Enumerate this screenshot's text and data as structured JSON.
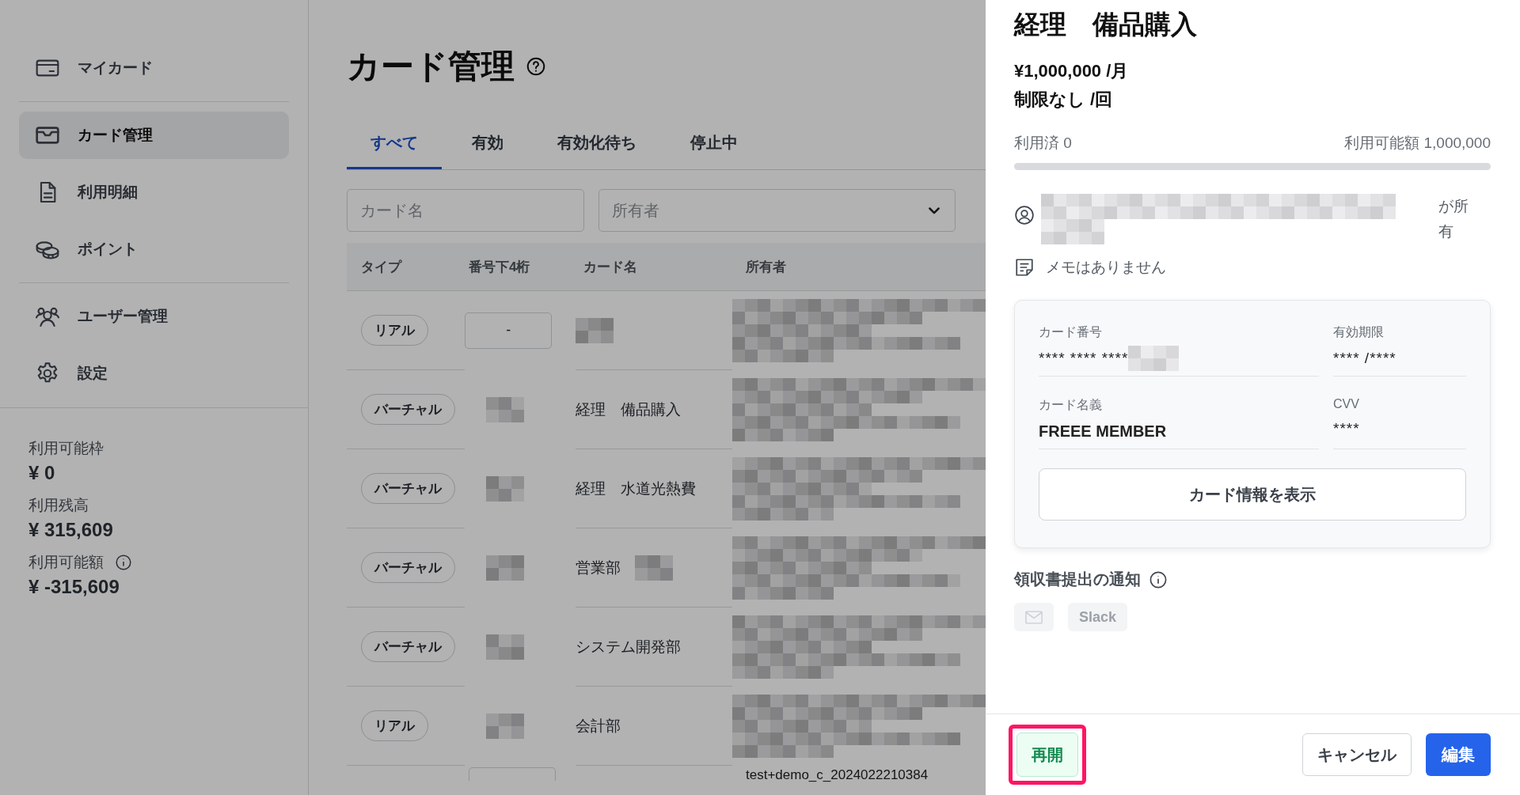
{
  "sidebar": {
    "nav_groups": [
      [
        {
          "label": "マイカード",
          "kind": "card",
          "selected": false
        }
      ],
      [
        {
          "label": "カード管理",
          "kind": "tray",
          "selected": true
        },
        {
          "label": "利用明細",
          "kind": "document",
          "selected": false
        },
        {
          "label": "ポイント",
          "kind": "coins",
          "selected": false
        }
      ],
      [
        {
          "label": "ユーザー管理",
          "kind": "users",
          "selected": false
        },
        {
          "label": "設定",
          "kind": "settings",
          "selected": false
        }
      ]
    ],
    "balances": [
      {
        "label": "利用可能枠",
        "value": "¥ 0",
        "info": false
      },
      {
        "label": "利用残高",
        "value": "¥ 315,609",
        "info": false
      },
      {
        "label": "利用可能額",
        "value": "¥ -315,609",
        "info": true
      }
    ]
  },
  "main": {
    "title": "カード管理",
    "tabs": [
      {
        "label": "すべて",
        "selected": true
      },
      {
        "label": "有効",
        "selected": false
      },
      {
        "label": "有効化待ち",
        "selected": false
      },
      {
        "label": "停止中",
        "selected": false
      }
    ],
    "filters": {
      "card_name_placeholder": "カード名",
      "owner_placeholder": "所有者"
    },
    "table": {
      "columns": [
        "タイプ",
        "番号下4桁",
        "カード名",
        "所有者"
      ],
      "rows": [
        {
          "type": "リアル",
          "last4": {
            "kind": "text",
            "text": "-"
          },
          "name": {
            "kind": "redacted"
          },
          "owner": {
            "kind": "redacted"
          }
        },
        {
          "type": "バーチャル",
          "last4": {
            "kind": "redacted"
          },
          "name": {
            "kind": "text",
            "text": "経理　備品購入"
          },
          "owner": {
            "kind": "redacted"
          }
        },
        {
          "type": "バーチャル",
          "last4": {
            "kind": "redacted"
          },
          "name": {
            "kind": "text",
            "text": "経理　水道光熱費"
          },
          "owner": {
            "kind": "redacted"
          }
        },
        {
          "type": "バーチャル",
          "last4": {
            "kind": "redacted"
          },
          "name": {
            "kind": "text_redacted",
            "text": "営業部"
          },
          "owner": {
            "kind": "redacted"
          }
        },
        {
          "type": "バーチャル",
          "last4": {
            "kind": "redacted"
          },
          "name": {
            "kind": "text",
            "text": "システム開発部"
          },
          "owner": {
            "kind": "redacted"
          }
        },
        {
          "type": "リアル",
          "last4": {
            "kind": "redacted"
          },
          "name": {
            "kind": "text",
            "text": "会計部"
          },
          "owner": {
            "kind": "redacted"
          }
        },
        {
          "last4": {
            "kind": "box"
          },
          "owner": {
            "kind": "text",
            "text": "test+demo_c_2024022210384"
          }
        }
      ]
    }
  },
  "drawer": {
    "title": "経理　備品購入",
    "monthly_limit": "¥1,000,000 /月",
    "per_use_limit": "制限なし /回",
    "usage": {
      "used": "利用済 0",
      "available": "利用可能額 1,000,000",
      "level": 0
    },
    "owner": {
      "redacted": true,
      "suffix": "が所有"
    },
    "memo": "メモはありません",
    "card": {
      "fields": [
        {
          "label": "カード番号",
          "value": "**** **** ****",
          "redacted_tail": true,
          "emphasis": false
        },
        {
          "label": "有効期限",
          "value": "**** /****",
          "redacted_tail": false,
          "emphasis": false
        },
        {
          "label": "カード名義",
          "value": "FREEE MEMBER",
          "redacted_tail": false,
          "emphasis": true
        },
        {
          "label": "CVV",
          "value": "****",
          "redacted_tail": false,
          "emphasis": false
        }
      ],
      "show_button": "カード情報を表示"
    },
    "notification": {
      "title": "領収書提出の通知",
      "channels": [
        {
          "kind": "email",
          "enabled": false
        },
        {
          "kind": "slack",
          "label": "Slack",
          "enabled": false
        }
      ]
    },
    "footer": {
      "resume": "再開",
      "highlighted": true,
      "cancel": "キャンセル",
      "edit": "編集"
    }
  }
}
